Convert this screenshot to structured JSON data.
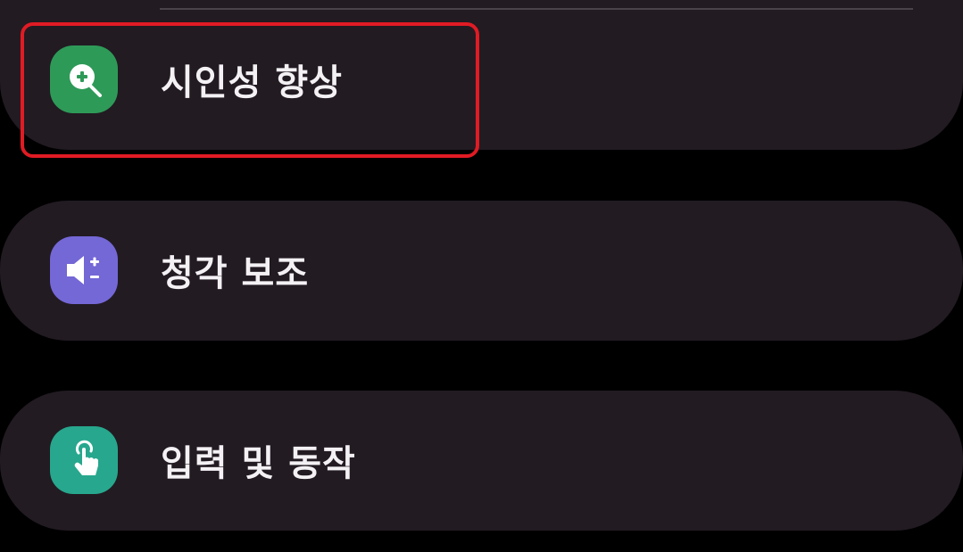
{
  "menu": {
    "items": [
      {
        "label": "시인성 향상",
        "icon": "magnifier-plus-icon",
        "icon_color": "#2e9a58"
      },
      {
        "label": "청각 보조",
        "icon": "speaker-plus-minus-icon",
        "icon_color": "#7467d6"
      },
      {
        "label": "입력 및 동작",
        "icon": "tap-hand-icon",
        "icon_color": "#27a78d"
      }
    ]
  },
  "highlight": {
    "color": "#e01b24",
    "target": "시인성 향상"
  }
}
